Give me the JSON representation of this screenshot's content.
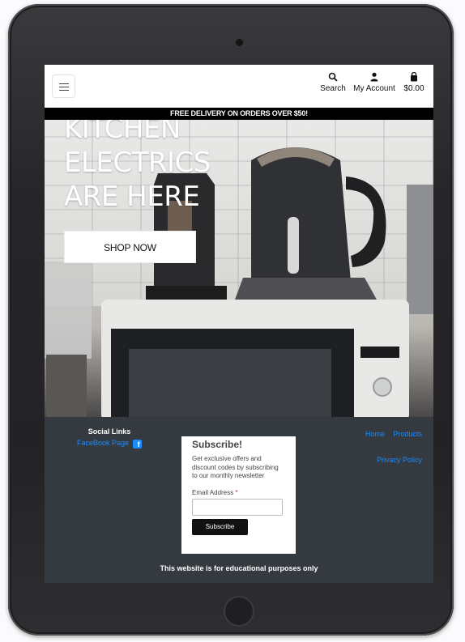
{
  "header": {
    "menu_icon": "hamburger-icon",
    "search_label": "Search",
    "account_label": "My Account",
    "cart_label": "$0.00",
    "icons": {
      "search": "search-icon",
      "account": "user-icon",
      "cart": "shopping-bag-icon"
    }
  },
  "banner": {
    "text": "FREE DELIVERY ON ORDERS OVER $50!"
  },
  "hero": {
    "title_lines": [
      "KITCHEN",
      "ELECTRICS",
      "ARE HERE"
    ],
    "shop_label": "SHOP NOW"
  },
  "footer": {
    "social_title": "Social Links",
    "social_link_label": "FaceBook Page",
    "social_icon": "facebook-icon",
    "links": [
      "Home",
      "Products"
    ],
    "privacy_label": "Privacy Policy",
    "subscribe": {
      "title": "Subscribe!",
      "text": "Get exclusive offers and discount codes by subscribing to our monthly newsletter",
      "email_label": "Email Address",
      "required_mark": "*",
      "button_label": "Subscribe"
    },
    "disclaimer": "This website is for educational purposes only"
  },
  "colors": {
    "footer_bg": "#343a40",
    "link": "#1a8cff",
    "banner_bg": "#000000"
  }
}
